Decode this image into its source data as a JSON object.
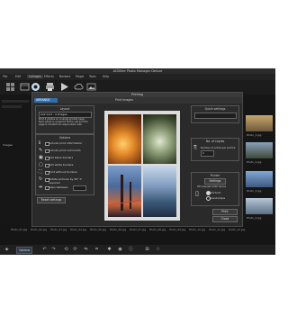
{
  "app": {
    "title": "ACDSee Photo Manager Deluxe",
    "menu": [
      "File",
      "Edit",
      "Collages",
      "Effects",
      "Borders",
      "Magic",
      "Tools",
      "Help"
    ],
    "active_menu": "Collages"
  },
  "sidebar": {
    "label": "Images"
  },
  "right_panel": {
    "captions": [
      "Photo_1.jpg",
      "Photo_2.jpg",
      "Photo_3.jpg",
      "Photo_4.jpg"
    ]
  },
  "bottom_strip": {
    "captions": [
      "Photo_01.jpg",
      "Photo_02.jpg",
      "Photo_03.jpg",
      "Photo_04.jpg",
      "Photo_05.jpg",
      "Photo_06.jpg",
      "Photo_07.jpg",
      "Photo_08.jpg",
      "Photo_09.jpg",
      "Photo_10.jpg",
      "Photo_11.jpg",
      "Photo_12.jpg"
    ]
  },
  "statusbar": {
    "options_label": "Options"
  },
  "dialog": {
    "title": "Printing",
    "active_tab": "ARRANGE",
    "print_tab": "Print images",
    "layout": {
      "title": "Layout",
      "value": "2x2 Grid - 4 images",
      "description": "Print 4 photos on a single printed page. Each photo is scaled to fit the cell and the page is divided into equal sized cells."
    },
    "options": {
      "title": "Options",
      "items": [
        "Include print information",
        "Include print comments",
        "Add black borders",
        "Add white borders",
        "Print without borders",
        "Rotate pictures by 90° if required",
        "Gaps between"
      ]
    },
    "reset_label": "Reset settings",
    "quick": {
      "title": "Quick settings",
      "value": ""
    },
    "copies": {
      "title": "No. of copies",
      "label": "Number of prints per picture",
      "value": "1"
    },
    "printer": {
      "title": "Printer",
      "button": "Settings",
      "desc": "HP LaserJet 2200 Series",
      "portrait": "Portrait",
      "landscape": "Landscape"
    },
    "print_label": "Print",
    "close_label": "Close"
  }
}
